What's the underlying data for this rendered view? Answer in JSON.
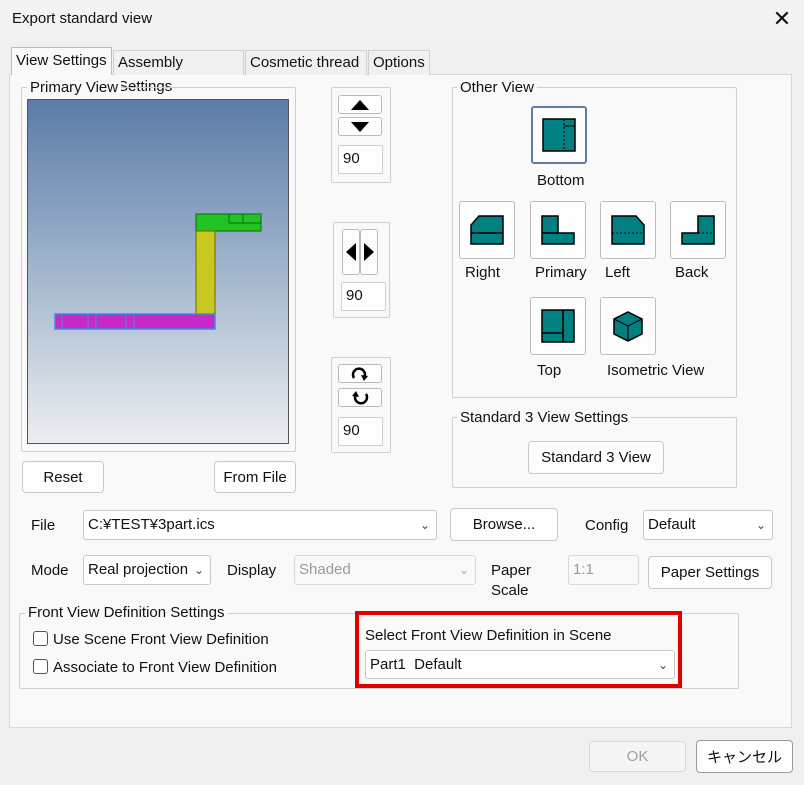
{
  "window": {
    "title": "Export standard view",
    "close_glyph": "✕"
  },
  "tabs": [
    "View Settings",
    "Assembly Settings",
    "Cosmetic thread",
    "Options"
  ],
  "primary_view": {
    "label": "Primary View",
    "reset_label": "Reset",
    "from_file_label": "From File"
  },
  "rotation": {
    "vertical_value": "90",
    "horizontal_value": "90",
    "roll_value": "90"
  },
  "other_view": {
    "label": "Other View",
    "views": {
      "bottom": "Bottom",
      "right": "Right",
      "primary": "Primary",
      "left": "Left",
      "back": "Back",
      "top": "Top",
      "isometric": "Isometric View"
    },
    "icon_color": "#008080"
  },
  "standard3": {
    "label": "Standard 3 View Settings",
    "button_label": "Standard 3 View"
  },
  "file": {
    "label": "File",
    "value": "C:¥TEST¥3part.ics",
    "browse_label": "Browse...",
    "config_label": "Config",
    "config_value": "Default"
  },
  "mode": {
    "label": "Mode",
    "value": "Real projection",
    "display_label": "Display",
    "display_value": "Shaded",
    "paper_scale_label_1": "Paper",
    "paper_scale_label_2": "Scale",
    "paper_scale_value": "1:1",
    "paper_settings_label": "Paper Settings"
  },
  "front_view": {
    "label": "Front View Definition Settings",
    "use_scene_label": "Use Scene Front View Definition",
    "use_scene_checked": false,
    "associate_label": "Associate to Front View Definition",
    "associate_checked": false,
    "select_label": "Select Front View Definition in Scene",
    "select_value": "Part1  Default",
    "highlight_color": "#e00000"
  },
  "footer": {
    "ok_label": "OK",
    "cancel_label": "キャンセル"
  }
}
